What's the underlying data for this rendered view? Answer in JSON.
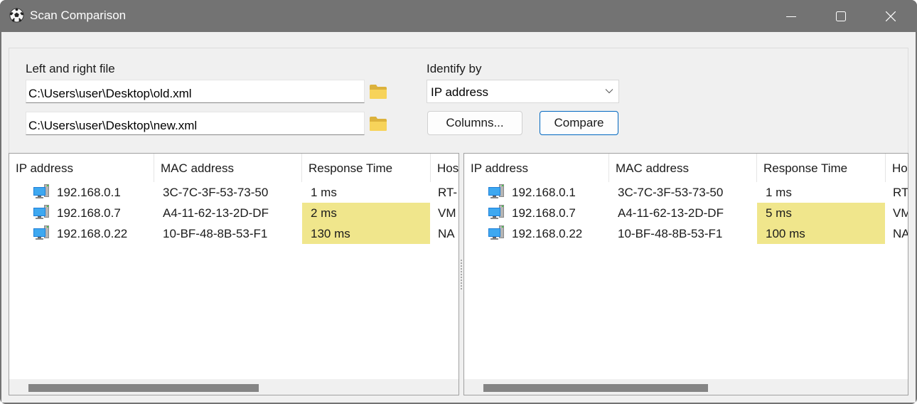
{
  "window": {
    "title": "Scan Comparison",
    "app_icon": "soccer-ball-icon",
    "controls": [
      "minimize",
      "maximize",
      "close"
    ]
  },
  "files": {
    "label": "Left and right file",
    "left_path": "C:\\Users\\user\\Desktop\\old.xml",
    "right_path": "C:\\Users\\user\\Desktop\\new.xml",
    "browse_icon": "folder-icon"
  },
  "identify": {
    "label": "Identify by",
    "selected": "IP address"
  },
  "buttons": {
    "columns": "Columns...",
    "compare": "Compare"
  },
  "columns": [
    "IP address",
    "MAC address",
    "Response Time",
    "Host"
  ],
  "left_list": {
    "header_visible": [
      "IP address",
      "MAC address",
      "Response Time",
      "Hos"
    ],
    "rows": [
      {
        "ip": "192.168.0.1",
        "mac": "3C-7C-3F-53-73-50",
        "response": "1 ms",
        "host": "RT-",
        "diff": false
      },
      {
        "ip": "192.168.0.7",
        "mac": "A4-11-62-13-2D-DF",
        "response": "2 ms",
        "host": "VM",
        "diff": true
      },
      {
        "ip": "192.168.0.22",
        "mac": "10-BF-48-8B-53-F1",
        "response": "130 ms",
        "host": "NA",
        "diff": true
      }
    ],
    "scroll_fraction": 0.0
  },
  "right_list": {
    "header_visible": [
      "IP address",
      "MAC address",
      "Response Time",
      "Ho"
    ],
    "rows": [
      {
        "ip": "192.168.0.1",
        "mac": "3C-7C-3F-53-73-50",
        "response": "1 ms",
        "host": "RT",
        "diff": false
      },
      {
        "ip": "192.168.0.7",
        "mac": "A4-11-62-13-2D-DF",
        "response": "5 ms",
        "host": "VM",
        "diff": true
      },
      {
        "ip": "192.168.0.22",
        "mac": "10-BF-48-8B-53-F1",
        "response": "100 ms",
        "host": "NA",
        "diff": true
      }
    ],
    "scroll_fraction": 0.0
  },
  "colors": {
    "diff_highlight": "#f0e68c",
    "titlebar": "#737373",
    "accent": "#0067c0"
  }
}
